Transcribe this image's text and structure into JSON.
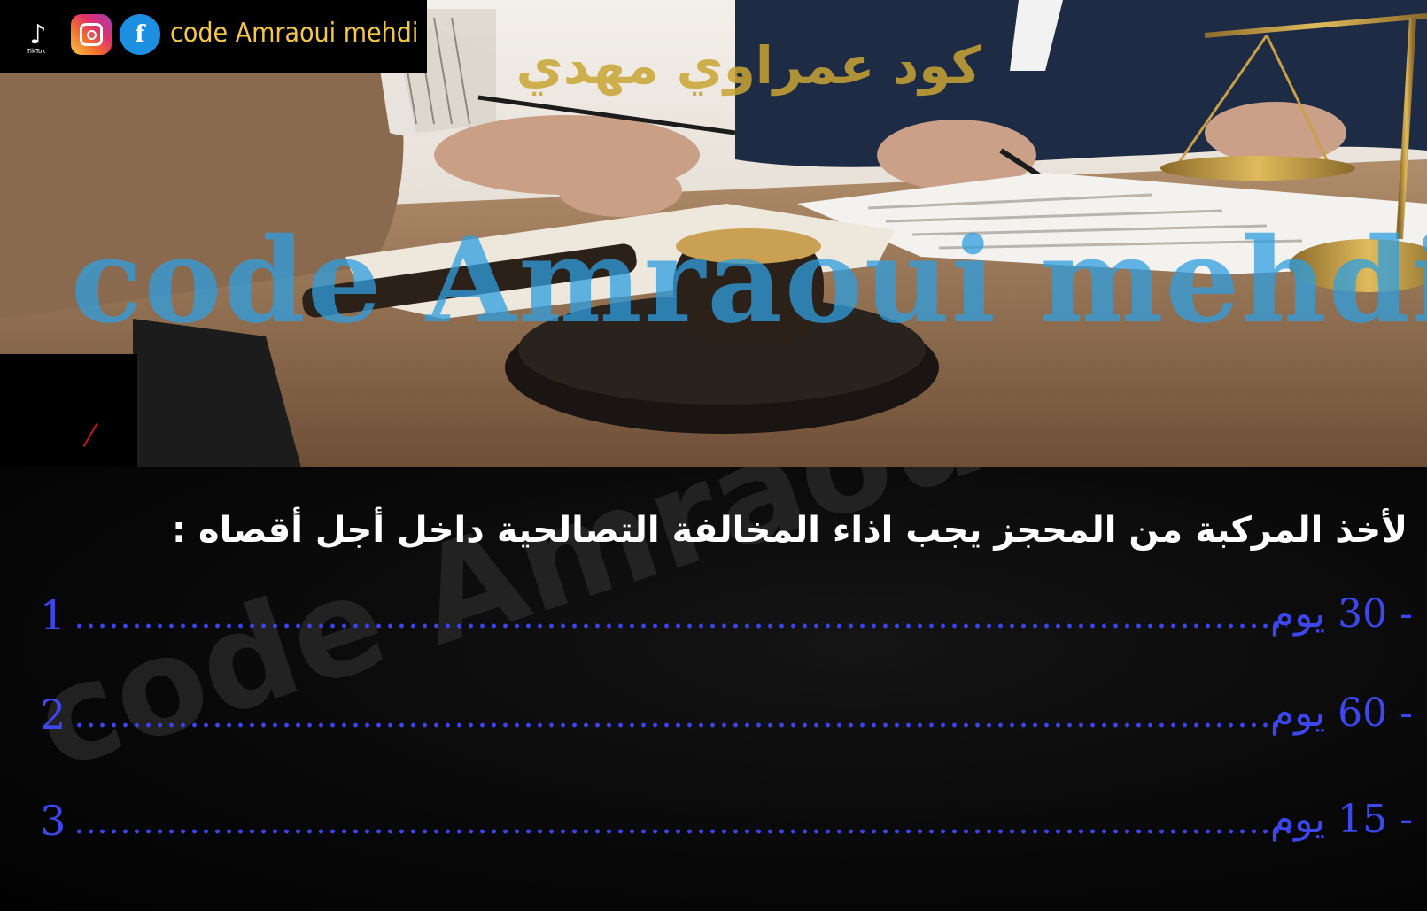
{
  "brand": {
    "handle": "code Amraoui mehdi",
    "tiktok_sub": "TikTok",
    "arabic_name": "كود عمراوي مهدي",
    "watermark_latin": "code Amraoui mehdi",
    "panel_watermark": "code Amraoui mehdi",
    "icons": [
      "tiktok-icon",
      "instagram-icon",
      "facebook-icon"
    ],
    "handle_color": "#f2c649"
  },
  "question": {
    "text": "لأخذ المركبة من المحجز يجب اذاء المخالفة التصالحية داخل أجل أقصاه :"
  },
  "answers": [
    {
      "number": "1",
      "label": "- 30 يوم"
    },
    {
      "number": "2",
      "label": "- 60 يوم"
    },
    {
      "number": "3",
      "label": "- 15 يوم"
    }
  ],
  "colors": {
    "answer": "#3d47f0",
    "question": "#ffffff",
    "watermark": "#2f9fe0",
    "arabic_watermark": "#c9a533"
  }
}
